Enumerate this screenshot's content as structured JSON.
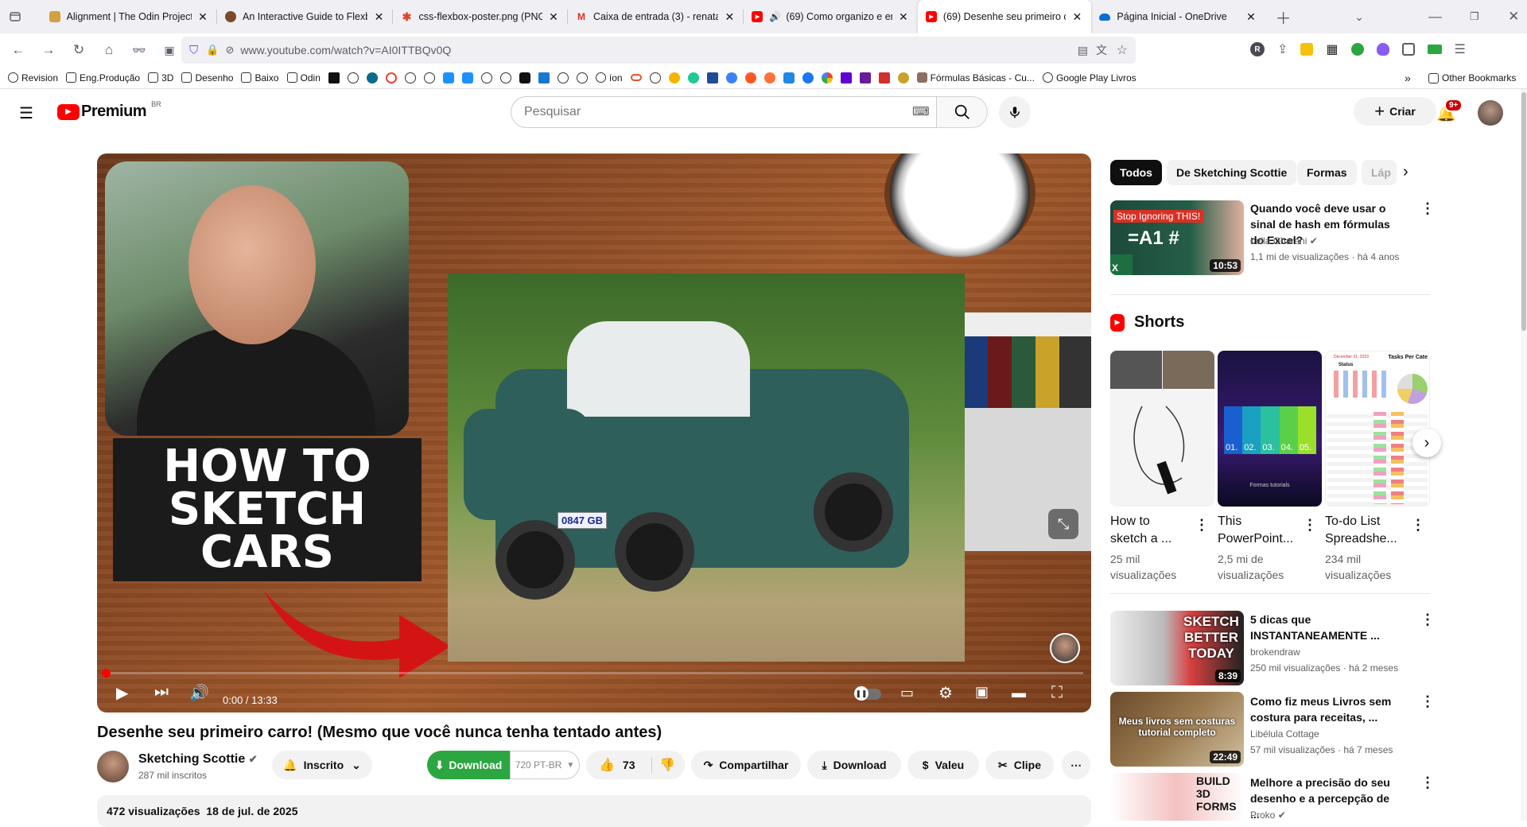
{
  "browser": {
    "tabs": [
      {
        "title": "Alignment | The Odin Project",
        "favicon_color": "#d4a040"
      },
      {
        "title": "An Interactive Guide to Flexbox",
        "favicon_color": "#7a4a2a"
      },
      {
        "title": "css-flexbox-poster.png (PNG Im",
        "favicon_color": "#e0442a"
      },
      {
        "title": "Caixa de entrada (3) - renatao.m",
        "favicon_color": "#d93025"
      },
      {
        "title": "(69) Como organizo e enco",
        "favicon_color": "#ff0000"
      },
      {
        "title": "(69) Desenhe seu primeiro carro",
        "favicon_color": "#ff0000"
      },
      {
        "title": "Página Inicial - OneDrive",
        "favicon_color": "#0a6cd4"
      }
    ],
    "url": "www.youtube.com/watch?v=AI0ITTBQv0Q",
    "bookmarks": [
      {
        "label": "Revision"
      },
      {
        "label": "Eng.Produção"
      },
      {
        "label": "3D"
      },
      {
        "label": "Desenho"
      },
      {
        "label": "Baixo"
      },
      {
        "label": "Odin"
      }
    ],
    "bookmark_ion": "íon",
    "bookmark_formulas": "Fórmulas Básicas - Cu...",
    "bookmark_playlivros": "Google Play Livros",
    "bookmark_other": "Other Bookmarks"
  },
  "youtube": {
    "logo_text": "Premium",
    "logo_region": "BR",
    "search_placeholder": "Pesquisar",
    "create_label": "Criar",
    "notif_badge": "9+"
  },
  "video": {
    "thumbnail_text_lines": [
      "HOW TO",
      "SKETCH",
      "CARS"
    ],
    "plate_text": "0847 GB",
    "time": "0:00 / 13:33",
    "progress_fraction": 0.0,
    "title": "Desenhe seu primeiro carro! (Mesmo que você nunca tenha tentado antes)",
    "channel": "Sketching Scottie",
    "subscribers": "287 mil inscritos",
    "subscribed_label": "Inscrito",
    "download_green_label": "Download",
    "quality_label": "720 PT-BR",
    "likes": "73",
    "share_label": "Compartilhar",
    "download_label": "Download",
    "thanks_label": "Valeu",
    "clip_label": "Clipe",
    "views_date": "472 visualizações  18 de jul. de 2025"
  },
  "sidebar": {
    "chips": [
      "Todos",
      "De Sketching Scottie",
      "Formas",
      "Láp"
    ],
    "recs_top": [
      {
        "thumb_text": "Stop Ignoring THIS!",
        "thumb_big": "=A1 #",
        "title": "Quando você deve usar o sinal de hash em fórmulas do Excel?",
        "channel": "Leila Gharani",
        "meta": "1,1 mi de visualizações · há 4 anos",
        "duration": "10:53"
      }
    ],
    "shorts_label": "Shorts",
    "shorts": [
      {
        "title": "How to sketch a ...",
        "views": "25 mil visualizações"
      },
      {
        "title": "This PowerPoint...",
        "views": "2,5 mi de visualizações",
        "labels": [
          "01.",
          "02.",
          "03.",
          "04.",
          "05."
        ],
        "caption": "Formas tutorials"
      },
      {
        "title": "To-do List Spreadshe...",
        "views": "234 mil visualizações",
        "header": "Tasks Per Cate",
        "date": "December 31, 2023",
        "status": "Status"
      }
    ],
    "recs_bottom": [
      {
        "thumb_text": "SKETCH BETTER TODAY",
        "title": "5 dicas que INSTANTANEAMENTE ...",
        "channel": "brokendraw",
        "meta": "250 mil visualizações · há 2 meses",
        "duration": "8:39"
      },
      {
        "thumb_text": "Meus livros sem costuras tutorial completo",
        "title": "Como fiz meus Livros sem costura para receitas, ...",
        "channel": "Libélula Cottage",
        "meta": "57 mil visualizações · há 7 meses",
        "duration": "22:49"
      },
      {
        "thumb_text": "BUILD 3D FORMS",
        "title": "Melhore a precisão do seu desenho e a percepção de ...",
        "channel": "Proko"
      }
    ]
  }
}
